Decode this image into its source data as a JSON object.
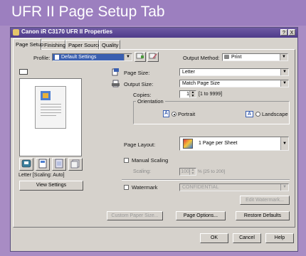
{
  "banner": {
    "title": "UFR II Page Setup Tab"
  },
  "window": {
    "title": "Canon iR C3170 UFR II Properties",
    "help_btn": "?",
    "close_btn": "X"
  },
  "tabs": [
    "Page Setup",
    "Finishing",
    "Paper Source",
    "Quality"
  ],
  "profile": {
    "label": "Profile:",
    "value": "Default Settings"
  },
  "output_method": {
    "label": "Output Method:",
    "value": "Print"
  },
  "preview": {
    "status": "Letter [Scaling: Auto]",
    "view_settings_btn": "View Settings"
  },
  "page_size": {
    "label": "Page Size:",
    "value": "Letter"
  },
  "output_size": {
    "label": "Output Size:",
    "value": "Match Page Size"
  },
  "copies": {
    "label": "Copies:",
    "value": "1",
    "range": "[1 to 9999]"
  },
  "orientation": {
    "label": "Orientation",
    "portrait": "Portrait",
    "landscape": "Landscape",
    "selected": "portrait"
  },
  "page_layout": {
    "label": "Page Layout:",
    "value": "1 Page per Sheet"
  },
  "manual_scaling": {
    "label": "Manual Scaling",
    "scaling_label": "Scaling:",
    "scaling_value": "100",
    "scaling_range": "% [25 to 200]"
  },
  "watermark": {
    "label": "Watermark",
    "value": "CONFIDENTIAL",
    "edit_btn": "Edit Watermark..."
  },
  "bottom_buttons": {
    "custom_paper": "Custom Paper Size...",
    "page_options": "Page Options...",
    "restore": "Restore Defaults"
  },
  "dialog_buttons": {
    "ok": "OK",
    "cancel": "Cancel",
    "help": "Help"
  }
}
